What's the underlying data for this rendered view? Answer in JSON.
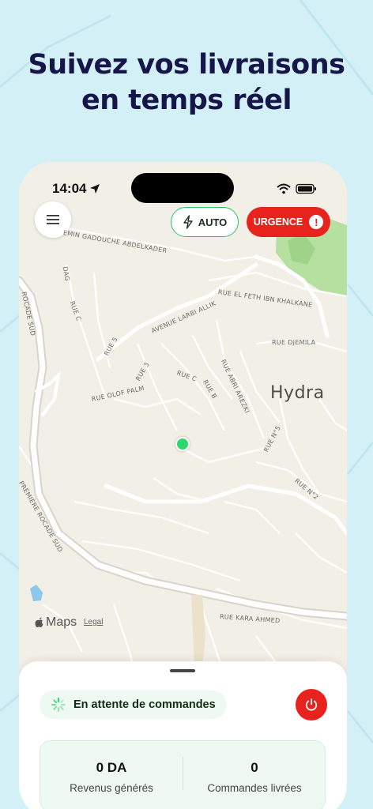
{
  "headline": {
    "line1": "Suivez vos livraisons",
    "line2": "en temps réel"
  },
  "status_bar": {
    "time": "14:04"
  },
  "top_controls": {
    "auto_label": "AUTO",
    "urgence_label": "URGENCE",
    "urgence_badge": "!"
  },
  "map": {
    "place_label": "Hydra",
    "attribution": "Maps",
    "legal": "Legal",
    "streets": [
      "EMIN GADOUCHE ABDELKADER",
      "AVENUE LARBI ALLIK",
      "RUE EL FETH IBN KHALKANE",
      "RUE DJEMILA",
      "ROCADE SUD",
      "DAG",
      "RUE C",
      "RUE 5",
      "RUE 3",
      "RUE OLOF PALM",
      "RUE C",
      "RUE B",
      "RUE ABRI AREZKI",
      "RUE N°5",
      "RUE N°2",
      "PREMIÈRE ROCADE SUD",
      "RUE KARA AHMED"
    ]
  },
  "sheet": {
    "status_text": "En attente de commandes",
    "stats": [
      {
        "value": "0 DA",
        "label": "Revenus générés"
      },
      {
        "value": "0",
        "label": "Commandes livrées"
      }
    ]
  },
  "colors": {
    "accent_green": "#2ed66e",
    "urgent_red": "#e8221c",
    "headline_navy": "#16164a",
    "background": "#d4f0f7"
  }
}
